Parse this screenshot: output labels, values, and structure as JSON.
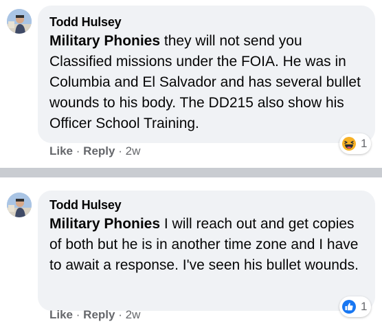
{
  "comments": [
    {
      "author": "Todd Hulsey",
      "mention": "Military Phonies",
      "text": " they will not send you Classified missions under the FOIA. He was in Columbia and El Salvador and has several bullet wounds to his body. The DD215 also show his Officer School Training.",
      "like_label": "Like",
      "reply_label": "Reply",
      "separator": "·",
      "time": "2w",
      "reaction_icon": "haha-icon",
      "reaction_count": "1"
    },
    {
      "author": "Todd Hulsey",
      "mention": "Military Phonies",
      "text": " I will reach out and get copies of both but he is in another time zone and I have to await a response. I've seen his bullet wounds.",
      "like_label": "Like",
      "reply_label": "Reply",
      "separator": "·",
      "time": "2w",
      "reaction_icon": "like-icon",
      "reaction_count": "1"
    }
  ],
  "colors": {
    "bubble": "#f0f2f5",
    "secondary_text": "#65676b",
    "like_blue": "#1877f2",
    "haha_yellow": "#f7b125",
    "divider": "#c9ccd1"
  }
}
